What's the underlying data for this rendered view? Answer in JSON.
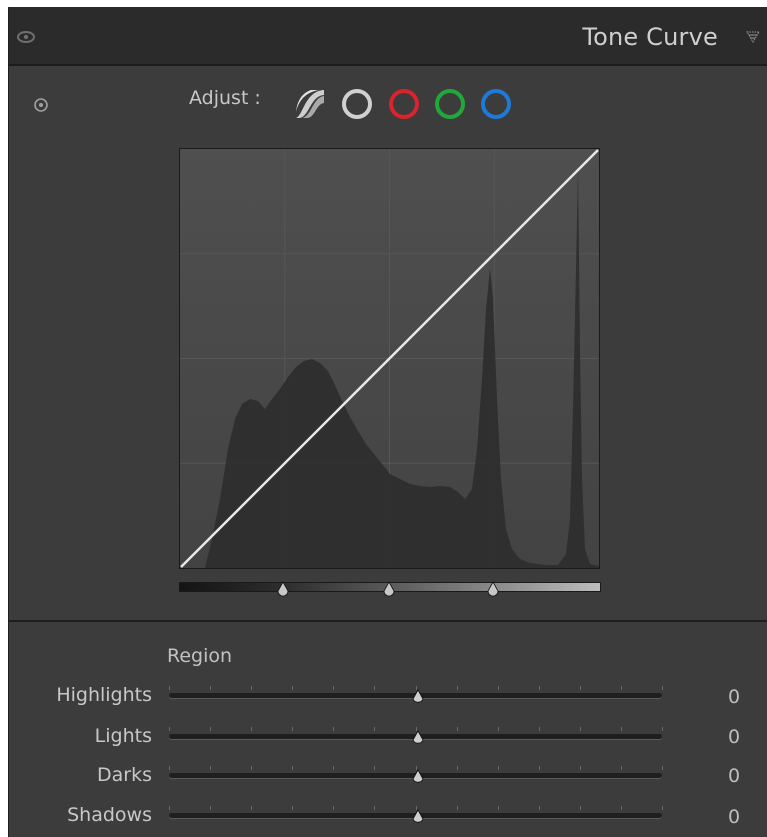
{
  "header": {
    "title": "Tone Curve",
    "visibility_icon": "eye-icon",
    "collapse_icon": "triangle-down-icon"
  },
  "adjust": {
    "label": "Adjust :",
    "channels": [
      {
        "name": "parametric-curve",
        "icon": "parametric-curve-icon",
        "color": "#cfcfcf"
      },
      {
        "name": "point-curve-rgb",
        "icon": "circle-icon",
        "color": "#d0d0d0"
      },
      {
        "name": "point-curve-red",
        "icon": "circle-icon",
        "color": "#d9232e"
      },
      {
        "name": "point-curve-green",
        "icon": "circle-icon",
        "color": "#22a83a"
      },
      {
        "name": "point-curve-blue",
        "icon": "circle-icon",
        "color": "#1f79d6"
      }
    ]
  },
  "region": {
    "label": "Region",
    "rows": [
      {
        "label": "Highlights",
        "value": "0"
      },
      {
        "label": "Lights",
        "value": "0"
      },
      {
        "label": "Darks",
        "value": "0"
      },
      {
        "label": "Shadows",
        "value": "0"
      }
    ]
  },
  "colors": {
    "panel_bg": "#3c3c3c",
    "header_bg": "#2b2b2b",
    "curve_line": "#e8e8e8",
    "histogram": "#2e2e2e"
  }
}
